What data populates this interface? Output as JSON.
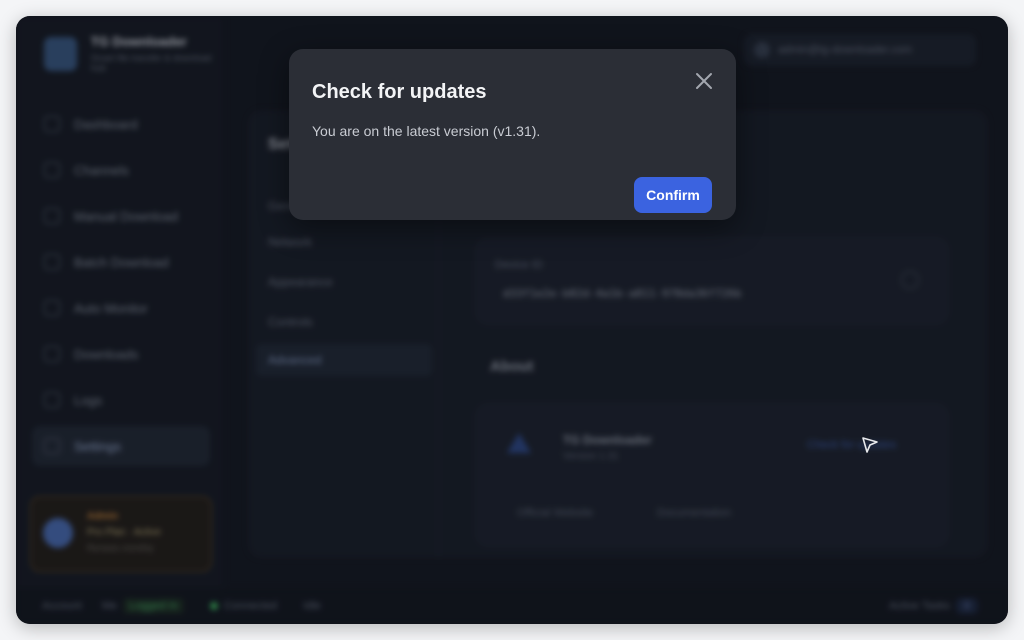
{
  "app": {
    "title": "TG Downloader",
    "subtitle": "Smart file transfer & download hub",
    "account": "admin@tg-downloader.com"
  },
  "sidebar": {
    "items": [
      {
        "label": "Dashboard",
        "active": false
      },
      {
        "label": "Channels",
        "active": false
      },
      {
        "label": "Manual Download",
        "active": false
      },
      {
        "label": "Batch Download",
        "active": false
      },
      {
        "label": "Auto Monitor",
        "active": false
      },
      {
        "label": "Downloads",
        "active": false
      },
      {
        "label": "Logs",
        "active": false
      },
      {
        "label": "Settings",
        "active": true
      }
    ],
    "upsell": {
      "line1": "Admin",
      "line2": "Pro Plan · Active",
      "line3": "Renews monthly"
    }
  },
  "settings": {
    "title": "Settings",
    "items": [
      {
        "label": "General"
      },
      {
        "label": "Network"
      },
      {
        "label": "Appearance"
      },
      {
        "label": "Controls"
      },
      {
        "label": "Advanced"
      }
    ],
    "device_id_label": "Device ID",
    "device_id": "d33f1e2e-b82d-4a1b-a811-978da36f726b",
    "about_title": "About",
    "about_app_name": "TG Downloader",
    "about_version": "Version 1.31",
    "check_updates_label": "Check for updates",
    "official_website": "Official Website",
    "documentation": "Documentation"
  },
  "statusbar": {
    "account_label": "Account",
    "account_value": "Me",
    "logged_in": "Logged In",
    "connected": "Connected",
    "idle": "Idle",
    "active_tasks": "Active Tasks",
    "active_tasks_count": "0"
  },
  "modal": {
    "title": "Check for updates",
    "message": "You are on the latest version (v1.31).",
    "confirm_label": "Confirm"
  },
  "colors": {
    "accent": "#3b63e0",
    "modal_bg": "#2b2e36",
    "app_bg": "#151922"
  }
}
